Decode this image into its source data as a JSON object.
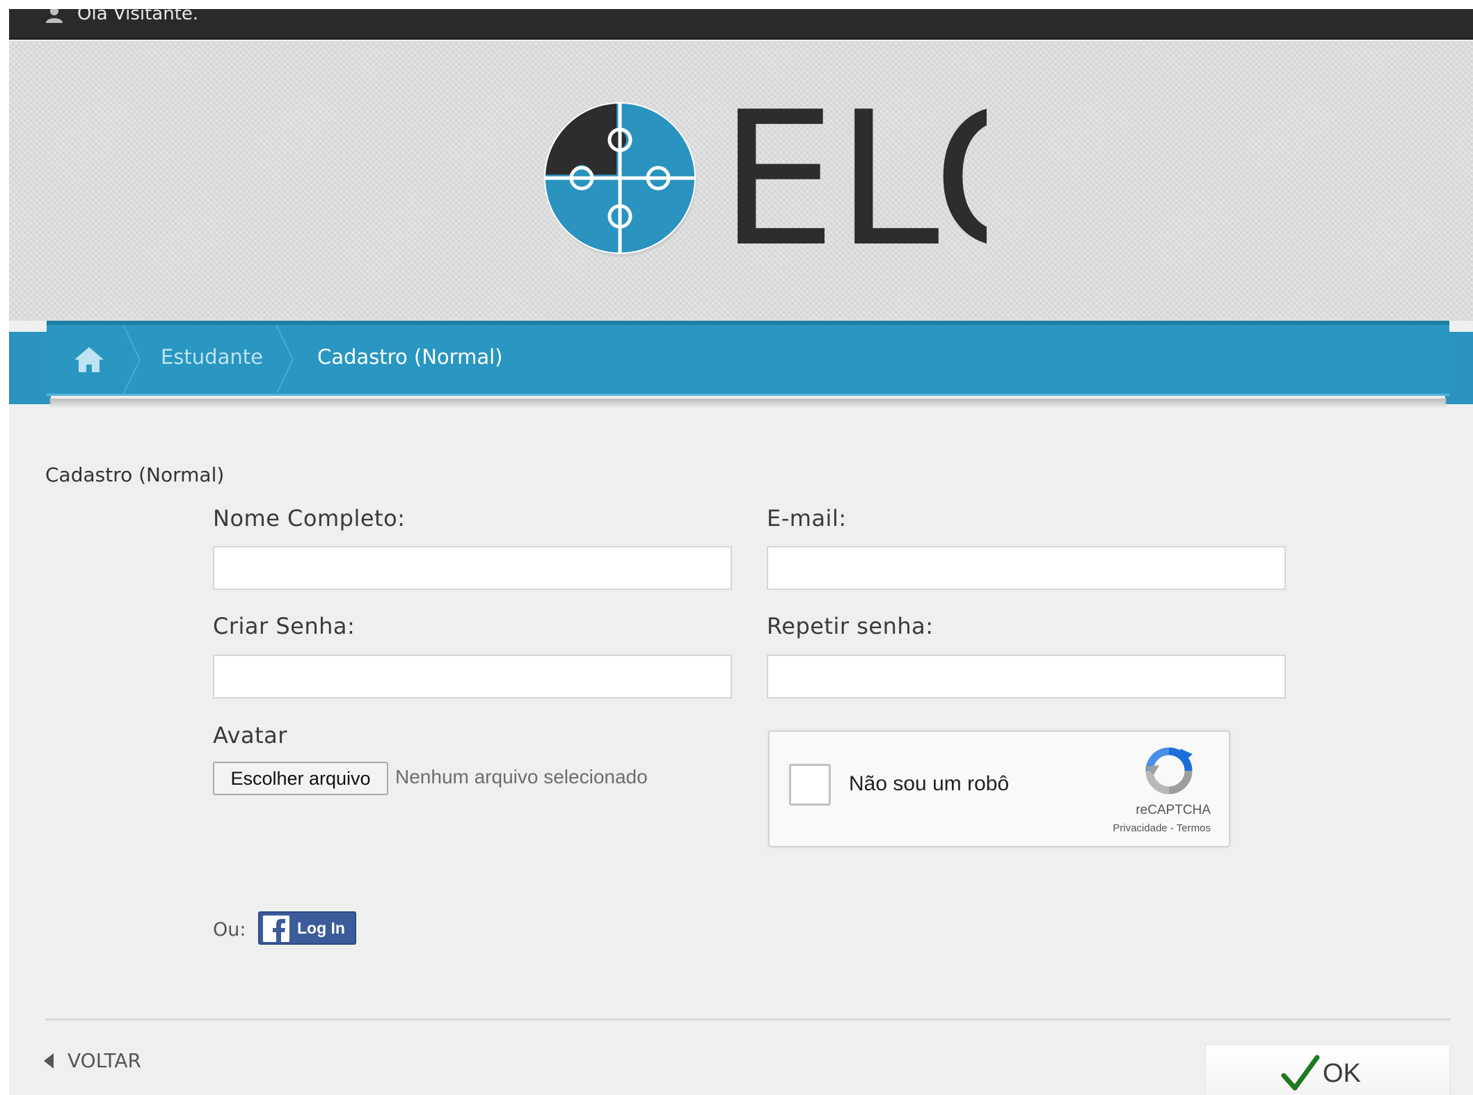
{
  "topbar": {
    "greeting": "Olá Visitante.",
    "user_icon": "user-icon"
  },
  "header": {
    "logo_text": "ELO",
    "logo_icon": "puzzle-logo-icon",
    "colors": {
      "logo_blue": "#2a93bf",
      "logo_dark": "#2d2d2d"
    }
  },
  "breadcrumb": {
    "home_icon": "home-icon",
    "items": [
      {
        "label": "Estudante"
      },
      {
        "label": "Cadastro (Normal)"
      }
    ],
    "color": "#2997c1"
  },
  "form": {
    "title": "Cadastro (Normal)",
    "nome_label": "Nome Completo:",
    "nome_value": "",
    "email_label": "E-mail:",
    "email_value": "",
    "senha_label": "Criar Senha:",
    "senha_value": "",
    "repetir_label": "Repetir senha:",
    "repetir_value": "",
    "avatar_label": "Avatar",
    "file_button": "Escolher arquivo",
    "file_status": "Nenhum arquivo selecionado"
  },
  "captcha": {
    "label": "Não sou um robô",
    "brand": "reCAPTCHA",
    "links": "Privacidade - Termos",
    "checked": false
  },
  "social": {
    "or_label": "Ou:",
    "facebook_button": "Log In",
    "facebook_color": "#3b5b9a"
  },
  "footer": {
    "back_label": "VOLTAR",
    "ok_label": "OK",
    "ok_icon": "checkmark-icon",
    "ok_icon_color": "#1f7a1f"
  }
}
